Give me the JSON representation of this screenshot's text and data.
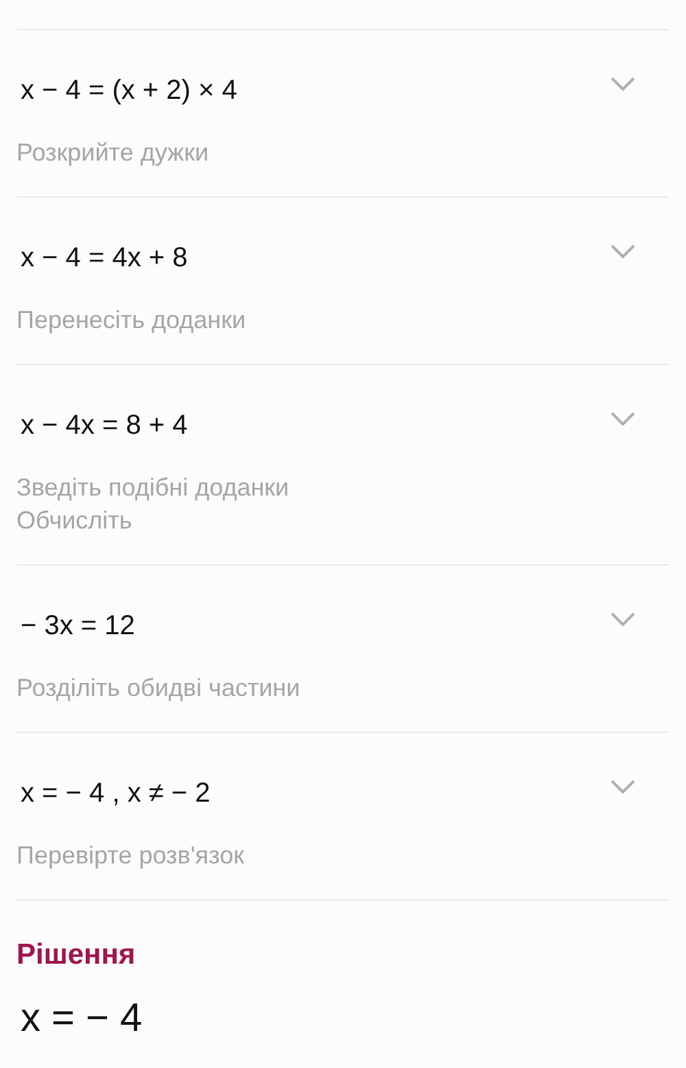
{
  "steps": [
    {
      "expression": "x − 4 = (x + 2) × 4",
      "hints": [
        "Розкрийте дужки"
      ],
      "expanded": false
    },
    {
      "expression": "x − 4 = 4x + 8",
      "hints": [
        "Перенесіть доданки"
      ],
      "expanded": false
    },
    {
      "expression": "x − 4x = 8 + 4",
      "hints": [
        "Зведіть подібні доданки",
        "Обчисліть"
      ],
      "expanded": false
    },
    {
      "expression": "− 3x = 12",
      "hints": [
        "Розділіть обидві частини"
      ],
      "expanded": false
    },
    {
      "expression": "x = − 4 , x ≠ − 2",
      "hints": [
        "Перевірте розв'язок"
      ],
      "expanded": false
    }
  ],
  "solution": {
    "title": "Рішення",
    "answer": "x = − 4"
  }
}
